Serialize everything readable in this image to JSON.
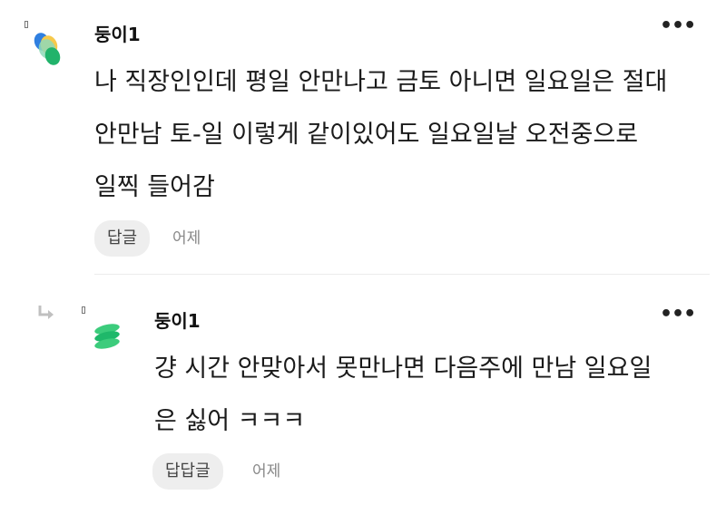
{
  "comments": [
    {
      "author": "둥이1",
      "more_icon": "more-horizontal-icon",
      "lines": [
        "나 직장인인데 평일 안만나고 금토 아니면 일요일은 절대",
        "안만남 토-일 이렇게 같이있어도 일요일날 오전중으로",
        "일찍 들어감"
      ],
      "reply_label": "답글",
      "time": "어제"
    },
    {
      "author": "둥이1",
      "more_icon": "more-horizontal-icon",
      "lines": [
        "걍 시간 안맞아서 못만나면 다음주에 만남 일요일",
        "은 싫어 ㅋㅋㅋ"
      ],
      "reply_label": "답답글",
      "time": "어제"
    }
  ],
  "more_symbol": "•••",
  "colors": {
    "avatar1": [
      "#2f7fe0",
      "#f6c94b",
      "#21b36b",
      "#8fd9b8"
    ],
    "avatar2": [
      "#1fb86a",
      "#3ccc7c"
    ],
    "reply_arrow": "#c0c0c0"
  }
}
